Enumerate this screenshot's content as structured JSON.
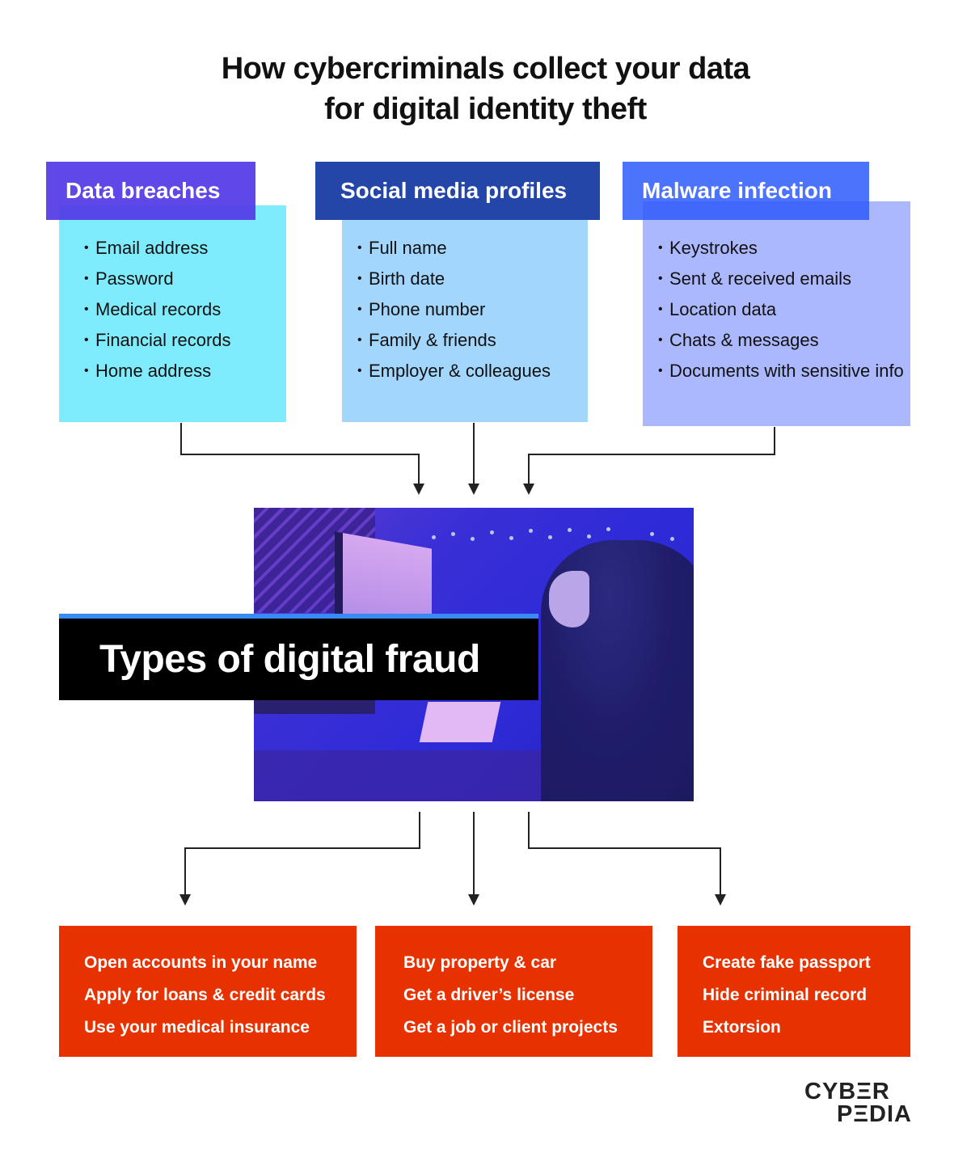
{
  "title": {
    "line1": "How cybercriminals collect your data",
    "line2": "for digital identity theft"
  },
  "sources": [
    {
      "heading": "Data breaches",
      "items": [
        "Email address",
        "Password",
        "Medical records",
        "Financial records",
        "Home address"
      ]
    },
    {
      "heading": "Social media profiles",
      "items": [
        "Full name",
        "Birth date",
        "Phone number",
        "Family & friends",
        "Employer & colleagues"
      ]
    },
    {
      "heading": "Malware infection",
      "items": [
        "Keystrokes",
        "Sent & received emails",
        "Location data",
        "Chats & messages",
        "Documents with sensitive info"
      ]
    }
  ],
  "center": {
    "label": "Types of digital fraud",
    "image": "hooded-hacker-at-computer-photo"
  },
  "outcomes": [
    {
      "items": [
        "Open accounts in your name",
        "Apply for loans & credit cards",
        "Use your medical insurance"
      ]
    },
    {
      "items": [
        "Buy property & car",
        "Get a driver’s license",
        "Get a job or client projects"
      ]
    },
    {
      "items": [
        "Create fake passport",
        "Hide criminal record",
        "Extorsion"
      ]
    }
  ],
  "logo": {
    "line1": "CYBΞR",
    "line2": "PΞDIA"
  },
  "colors": {
    "data_breaches_header": "#5238e6",
    "data_breaches_body": "#7fecfd",
    "social_header": "#2446a8",
    "social_body": "#a2d6fd",
    "malware_header": "#2d5afa",
    "malware_body": "#acb8fd",
    "outcome_box": "#e73200",
    "arrows": "#222222"
  }
}
